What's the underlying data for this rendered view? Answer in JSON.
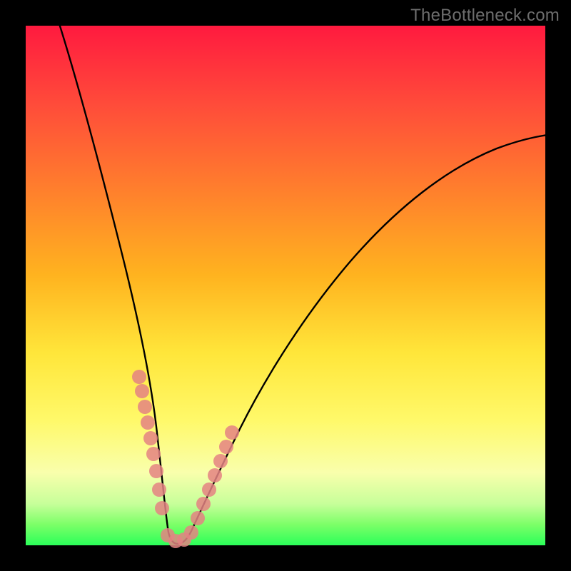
{
  "watermark": "TheBottleneck.com",
  "colors": {
    "frame_bg_top": "#ff1a3f",
    "frame_bg_bottom": "#2bff59",
    "border": "#000000",
    "curve": "#000000",
    "dots": "#e48282",
    "watermark": "#6d6d6d"
  },
  "chart_data": {
    "type": "line",
    "title": "",
    "xlabel": "",
    "ylabel": "",
    "xlim": [
      0,
      100
    ],
    "ylim": [
      0,
      100
    ],
    "grid": false,
    "series": [
      {
        "name": "bottleneck-curve",
        "x": [
          0,
          3,
          6,
          9,
          12,
          15,
          18,
          21,
          23,
          24.5,
          25.5,
          26.5,
          28,
          30,
          35,
          42,
          50,
          58,
          66,
          74,
          82,
          90,
          100
        ],
        "y": [
          110,
          95,
          80,
          65,
          50,
          37,
          26,
          16,
          8,
          3,
          1.2,
          1,
          1.2,
          3,
          10,
          22,
          35,
          46,
          55,
          63,
          70,
          75,
          80
        ]
      }
    ],
    "markers": [
      {
        "name": "dots-left",
        "x": [
          17.5,
          18.5,
          19.5,
          20.5,
          21.5,
          22.5,
          23.2,
          24.0,
          24.8
        ],
        "y": [
          29,
          25,
          21,
          17.5,
          14,
          10.5,
          7.5,
          5,
          3
        ]
      },
      {
        "name": "dots-bottom",
        "x": [
          25.3,
          26.0,
          26.8,
          27.6
        ],
        "y": [
          1.3,
          1.0,
          1.1,
          1.6
        ]
      },
      {
        "name": "dots-right",
        "x": [
          28.4,
          29.2,
          30.0,
          30.8,
          31.6,
          32.4,
          33.2
        ],
        "y": [
          3.2,
          5.0,
          7.5,
          10,
          12.5,
          15,
          17.5
        ]
      }
    ],
    "vertex": {
      "x": 26.2,
      "y": 1.0
    }
  }
}
